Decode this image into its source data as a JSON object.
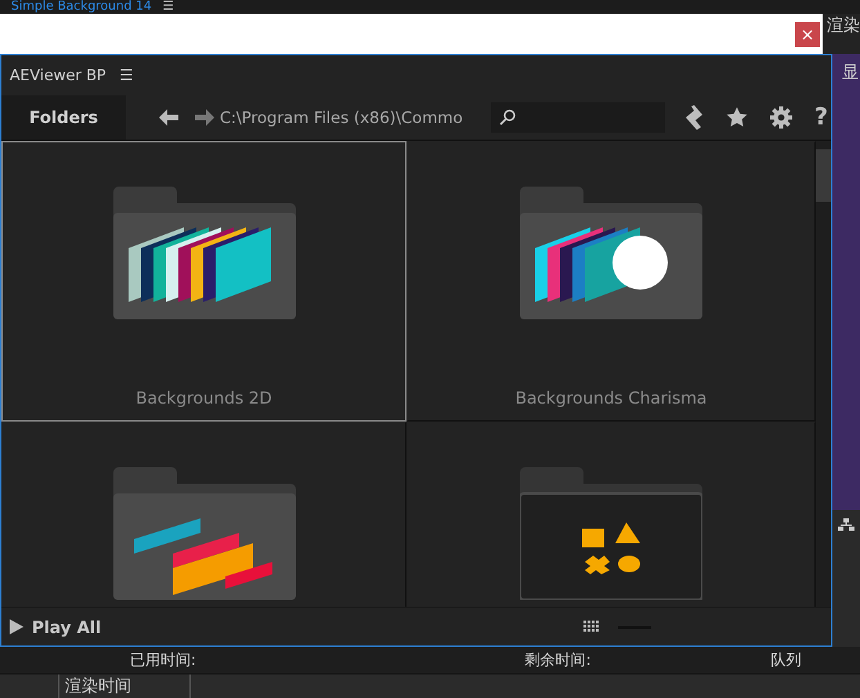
{
  "background_app": {
    "composition_tab": "Simple Background 14",
    "composition_menu": "☰",
    "render_label": "渲染",
    "side_label": "显",
    "elapsed": "已用时间:",
    "remaining": "剩余时间:",
    "queue": "队列",
    "render_time": "渲染时间"
  },
  "dialog": {
    "close": "×"
  },
  "panel": {
    "title": "AEViewer BP",
    "menu": "☰",
    "tabs": [
      {
        "label": "Folders",
        "selected": true
      }
    ],
    "path": "C:\\Program Files (x86)\\Commo",
    "help": "?",
    "folders": [
      {
        "label": "Backgrounds 2D",
        "selected": true,
        "kind": "cards"
      },
      {
        "label": "Backgrounds Charisma",
        "selected": false,
        "kind": "bright"
      },
      {
        "selected": false,
        "kind": "badges"
      },
      {
        "selected": false,
        "kind": "shapes"
      }
    ],
    "footer": {
      "play": "Play All"
    }
  }
}
